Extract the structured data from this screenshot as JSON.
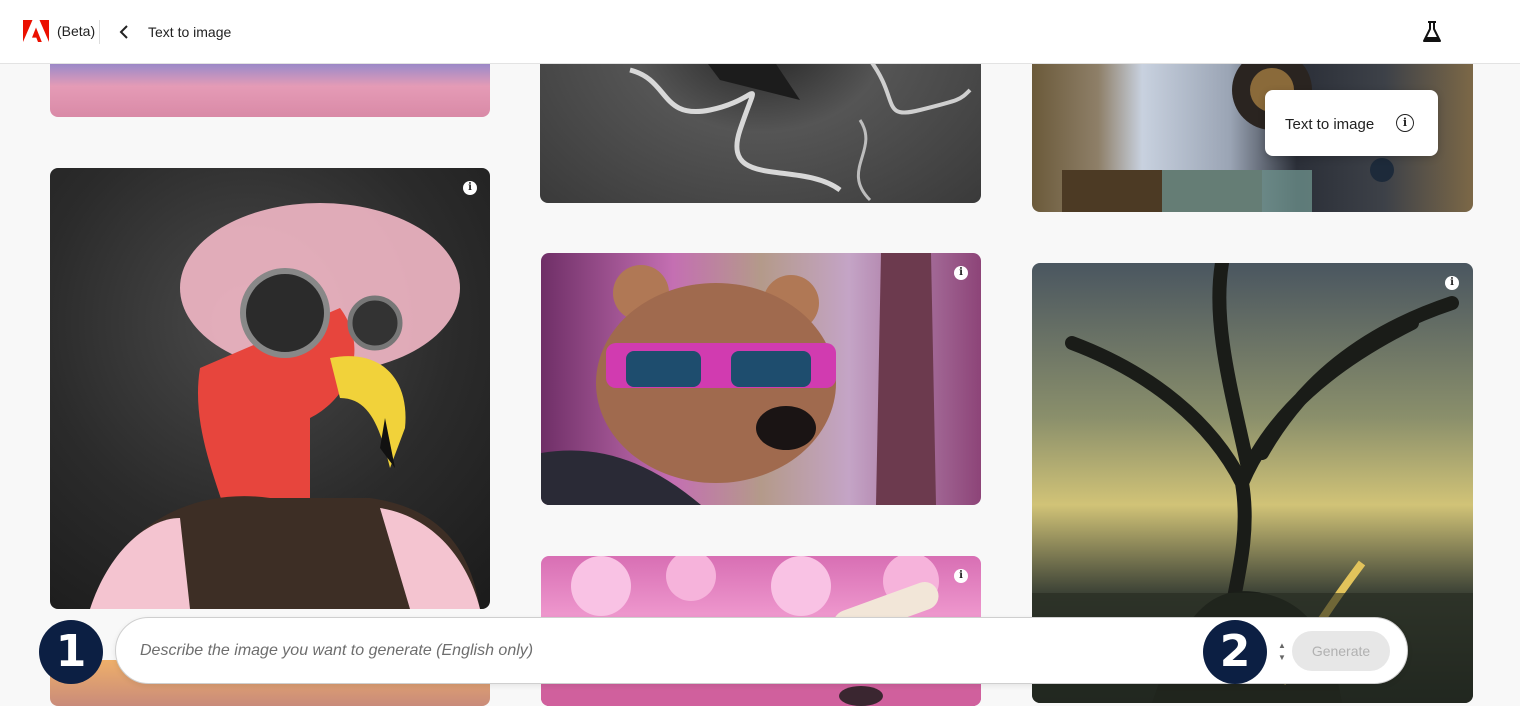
{
  "header": {
    "logo_icon": "adobe-logo-icon",
    "beta_label": "(Beta)",
    "back_icon": "chevron-left-icon",
    "breadcrumb": "Text to image",
    "labs_icon": "flask-icon"
  },
  "gallery": {
    "info_icon": "info-icon",
    "info_glyph": "i",
    "images": [
      {
        "subject": "abstract-gradient"
      },
      {
        "subject": "river-landscape"
      },
      {
        "subject": "steampunk-machine"
      },
      {
        "subject": "flamingo-with-goggles"
      },
      {
        "subject": "bear-with-sunglasses"
      },
      {
        "subject": "bare-tree-at-sunset"
      },
      {
        "subject": "cherry-blossom-still-life"
      },
      {
        "subject": "sunset-sky"
      }
    ]
  },
  "tooltip": {
    "label": "Text to image",
    "icon": "info-circle-icon",
    "glyph": "i"
  },
  "prompt": {
    "placeholder": "Describe the image you want to generate (English only)",
    "value": "",
    "generate_label": "Generate"
  },
  "markers": [
    "1",
    "2"
  ],
  "colors": {
    "header_bg": "#ffffff",
    "page_bg": "#f8f8f8",
    "adobe_red": "#eb1000",
    "marker_bg": "#0c1f43",
    "generate_disabled_bg": "#e7e7e7",
    "generate_disabled_text": "#b1b1b1"
  }
}
